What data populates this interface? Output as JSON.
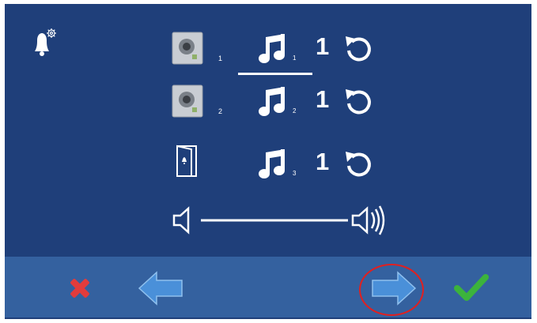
{
  "header": {
    "icon": "bell-settings-icon"
  },
  "rows": [
    {
      "source_icon": "outdoor-panel-icon",
      "source_num": "1",
      "melody_num": "1",
      "melody_value": "1",
      "selected": true
    },
    {
      "source_icon": "outdoor-panel-icon",
      "source_num": "2",
      "melody_num": "2",
      "melody_value": "1",
      "selected": false
    },
    {
      "source_icon": "door-bell-icon",
      "source_num": "",
      "melody_num": "3",
      "melody_value": "1",
      "selected": false
    }
  ],
  "volume": {
    "level": 1.0
  },
  "toolbar": {
    "buttons": [
      "cancel-icon",
      "back-arrow-icon",
      "next-arrow-icon",
      "confirm-icon"
    ],
    "highlighted": "next-arrow-icon"
  },
  "colors": {
    "background": "#1f3f7a",
    "toolbar": "#34619f",
    "cancel": "#e23c3c",
    "confirm": "#3cb33c",
    "arrow": "#4a90d9",
    "highlight": "#e02020"
  }
}
